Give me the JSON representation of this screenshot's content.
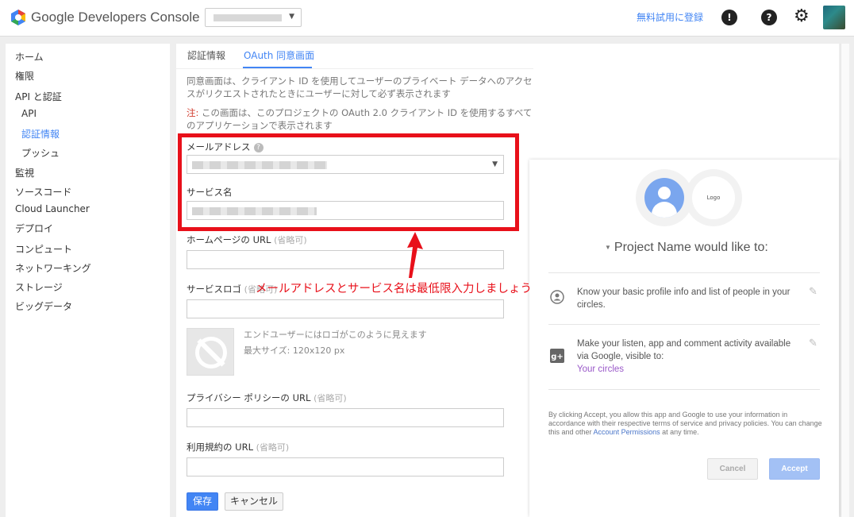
{
  "header": {
    "brand": "Google Developers Console",
    "trial_link": "無料試用に登録",
    "alert_icon": "!",
    "help_icon": "?",
    "settings_icon": "gear-icon"
  },
  "sidebar": {
    "items": [
      {
        "label": "ホーム"
      },
      {
        "label": "権限"
      },
      {
        "label": "API と認証"
      },
      {
        "label": "API"
      },
      {
        "label": "認証情報"
      },
      {
        "label": "プッシュ"
      },
      {
        "label": "監視"
      },
      {
        "label": "ソースコード"
      },
      {
        "label": "Cloud Launcher"
      },
      {
        "label": "デプロイ"
      },
      {
        "label": "コンピュート"
      },
      {
        "label": "ネットワーキング"
      },
      {
        "label": "ストレージ"
      },
      {
        "label": "ビッグデータ"
      }
    ]
  },
  "tabs": {
    "credentials": "認証情報",
    "consent": "OAuth 同意画面"
  },
  "content": {
    "description": "同意画面は、クライアント ID を使用してユーザーのプライベート データへのアクセスがリクエストされたときにユーザーに対して必ず表示されます",
    "note_label": "注:",
    "note_text": " この画面は、このプロジェクトの OAuth 2.0 クライアント ID を使用するすべてのアプリケーションで表示されます"
  },
  "form": {
    "email_label": "メールアドレス",
    "service_label": "サービス名",
    "homepage_label": "ホームページの URL",
    "logo_label": "サービスロゴ",
    "privacy_label": "プライバシー ポリシーの URL",
    "terms_label": "利用規約の URL",
    "optional": "(省略可)",
    "logo_hint": "エンドユーザーにはロゴがこのように見えます",
    "logo_maxsize": "最大サイズ: 120x120 px",
    "save": "保存",
    "cancel": "キャンセル"
  },
  "annotation": {
    "text": "メールアドレスとサービス名は最低限入力しましょう",
    "color": "#e8101a"
  },
  "preview": {
    "logo_text": "Logo",
    "title": "Project Name would like to:",
    "perm1": "Know your basic profile info and list of people in your circles.",
    "perm2": "Make your listen, app and comment activity available via Google, visible to:",
    "perm2_link": "Your circles",
    "fine_print": "By clicking Accept, you allow this app and Google to use your information in accordance with their respective terms of service and privacy policies. You can change this and other ",
    "fine_link": "Account Permissions",
    "fine_end": " at any time.",
    "cancel": "Cancel",
    "accept": "Accept"
  },
  "colors": {
    "accent": "#4285f4",
    "link_purple": "#9a59c9"
  }
}
